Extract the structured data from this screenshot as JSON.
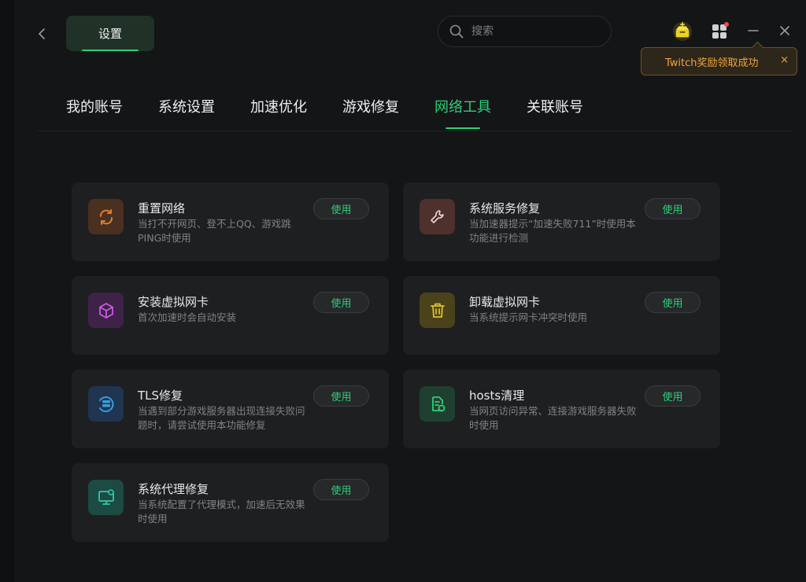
{
  "header": {
    "title": "设置",
    "search_placeholder": "搜索"
  },
  "toast": {
    "message": "Twitch奖励领取成功",
    "close": "×"
  },
  "tabs": [
    {
      "label": "我的账号"
    },
    {
      "label": "系统设置"
    },
    {
      "label": "加速优化"
    },
    {
      "label": "游戏修复"
    },
    {
      "label": "网络工具",
      "active": true
    },
    {
      "label": "关联账号"
    }
  ],
  "tools": [
    {
      "name": "重置网络",
      "desc": "当打不开网页、登不上QQ、游戏跳PING时使用",
      "button": "使用",
      "icon": "refresh-icon",
      "color": "#e07b2a"
    },
    {
      "name": "系统服务修复",
      "desc": "当加速器提示“加速失败711”时使用本功能进行检测",
      "button": "使用",
      "icon": "wrench-icon",
      "color": "#e0756a"
    },
    {
      "name": "安装虚拟网卡",
      "desc": "首次加速时会自动安装",
      "button": "使用",
      "icon": "cube-icon",
      "color": "#c95ce0"
    },
    {
      "name": "卸载虚拟网卡",
      "desc": "当系统提示网卡冲突时使用",
      "button": "使用",
      "icon": "trash-icon",
      "color": "#e0c02a"
    },
    {
      "name": "TLS修复",
      "desc": "当遇到部分游戏服务器出现连接失败问题时，请尝试使用本功能修复",
      "button": "使用",
      "icon": "server-refresh-icon",
      "color": "#3a9be0"
    },
    {
      "name": "hosts清理",
      "desc": "当网页访问异常、连接游戏服务器失败时使用",
      "button": "使用",
      "icon": "document-clean-icon",
      "color": "#2ecf7a"
    },
    {
      "name": "系统代理修复",
      "desc": "当系统配置了代理模式，加速后无效果时使用",
      "button": "使用",
      "icon": "monitor-icon",
      "color": "#2ec9b0"
    }
  ]
}
